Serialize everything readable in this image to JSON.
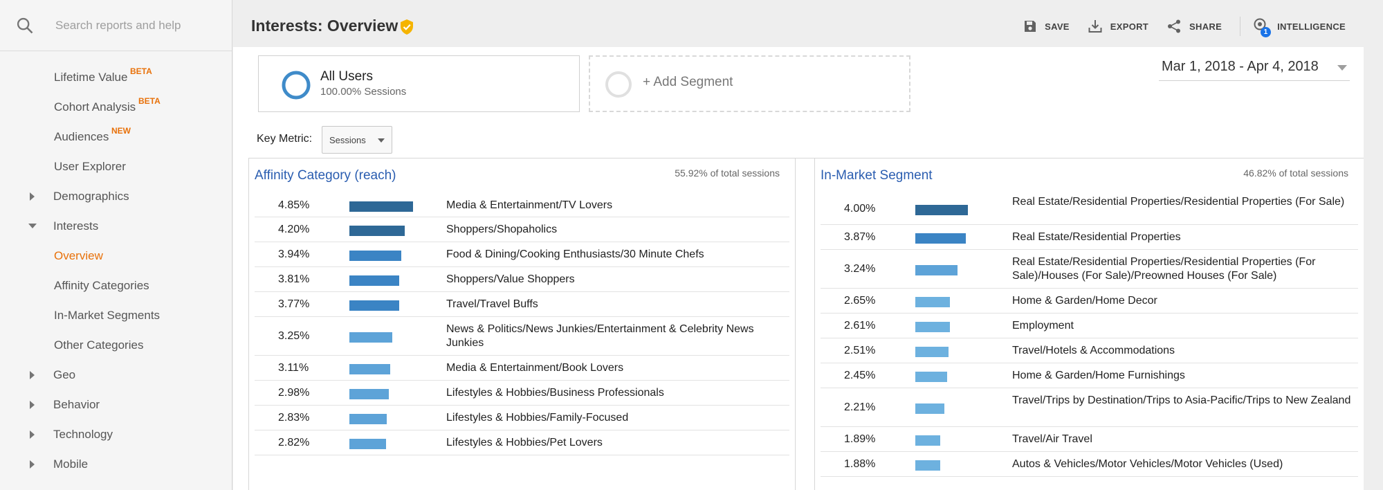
{
  "search": {
    "placeholder": "Search reports and help"
  },
  "sidebar": {
    "items": [
      {
        "label": "Lifetime Value",
        "badge": "BETA",
        "type": "child"
      },
      {
        "label": "Cohort Analysis",
        "badge": "BETA",
        "type": "child"
      },
      {
        "label": "Audiences",
        "badge": "NEW",
        "type": "child"
      },
      {
        "label": "User Explorer",
        "badge": "",
        "type": "child"
      },
      {
        "label": "Demographics",
        "badge": "",
        "type": "collapsed"
      },
      {
        "label": "Interests",
        "badge": "",
        "type": "expanded"
      },
      {
        "label": "Overview",
        "badge": "",
        "type": "child",
        "active": true
      },
      {
        "label": "Affinity Categories",
        "badge": "",
        "type": "child"
      },
      {
        "label": "In-Market Segments",
        "badge": "",
        "type": "child"
      },
      {
        "label": "Other Categories",
        "badge": "",
        "type": "child"
      },
      {
        "label": "Geo",
        "badge": "",
        "type": "collapsed"
      },
      {
        "label": "Behavior",
        "badge": "",
        "type": "collapsed"
      },
      {
        "label": "Technology",
        "badge": "",
        "type": "collapsed"
      },
      {
        "label": "Mobile",
        "badge": "",
        "type": "collapsed"
      }
    ]
  },
  "header": {
    "title": "Interests: Overview",
    "save_label": "SAVE",
    "export_label": "EXPORT",
    "share_label": "SHARE",
    "intelligence_label": "INTELLIGENCE",
    "intelligence_count": "1"
  },
  "segments": {
    "primary_name": "All Users",
    "primary_sub": "100.00% Sessions",
    "add_label": "+ Add Segment"
  },
  "date_range": "Mar 1, 2018 - Apr 4, 2018",
  "key_metric": {
    "label": "Key Metric:",
    "selected": "Sessions"
  },
  "colors": {
    "accent_orange": "#e8710a",
    "title_blue": "#2a5db0",
    "bar_dark": "#2e6896",
    "bar_mid": "#3b84c4",
    "bar_light": "#5da3d8",
    "bar_lighter": "#6db1df",
    "segment_ring": "#3f8bc9",
    "verified": "#f5b400"
  },
  "affinity": {
    "title": "Affinity Category (reach)",
    "pct_of_total": "55.92% of total sessions",
    "rows": [
      {
        "value": "4.85%",
        "name": "Media & Entertainment/TV Lovers"
      },
      {
        "value": "4.20%",
        "name": "Shoppers/Shopaholics"
      },
      {
        "value": "3.94%",
        "name": "Food & Dining/Cooking Enthusiasts/30 Minute Chefs"
      },
      {
        "value": "3.81%",
        "name": "Shoppers/Value Shoppers"
      },
      {
        "value": "3.77%",
        "name": "Travel/Travel Buffs"
      },
      {
        "value": "3.25%",
        "name": "News & Politics/News Junkies/Entertainment & Celebrity News Junkies"
      },
      {
        "value": "3.11%",
        "name": "Media & Entertainment/Book Lovers"
      },
      {
        "value": "2.98%",
        "name": "Lifestyles & Hobbies/Business Professionals"
      },
      {
        "value": "2.83%",
        "name": "Lifestyles & Hobbies/Family-Focused"
      },
      {
        "value": "2.82%",
        "name": "Lifestyles & Hobbies/Pet Lovers"
      }
    ]
  },
  "inmarket": {
    "title": "In-Market Segment",
    "pct_of_total": "46.82% of total sessions",
    "rows": [
      {
        "value": "4.00%",
        "name": "Real Estate/Residential Properties/Residential Properties (For Sale)"
      },
      {
        "value": "3.87%",
        "name": "Real Estate/Residential Properties"
      },
      {
        "value": "3.24%",
        "name": "Real Estate/Residential Properties/Residential Properties (For Sale)/Houses (For Sale)/Preowned Houses (For Sale)"
      },
      {
        "value": "2.65%",
        "name": "Home & Garden/Home Decor"
      },
      {
        "value": "2.61%",
        "name": "Employment"
      },
      {
        "value": "2.51%",
        "name": "Travel/Hotels & Accommodations"
      },
      {
        "value": "2.45%",
        "name": "Home & Garden/Home Furnishings"
      },
      {
        "value": "2.21%",
        "name": "Travel/Trips by Destination/Trips to Asia-Pacific/Trips to New Zealand"
      },
      {
        "value": "1.89%",
        "name": "Travel/Air Travel"
      },
      {
        "value": "1.88%",
        "name": "Autos & Vehicles/Motor Vehicles/Motor Vehicles (Used)"
      }
    ]
  }
}
